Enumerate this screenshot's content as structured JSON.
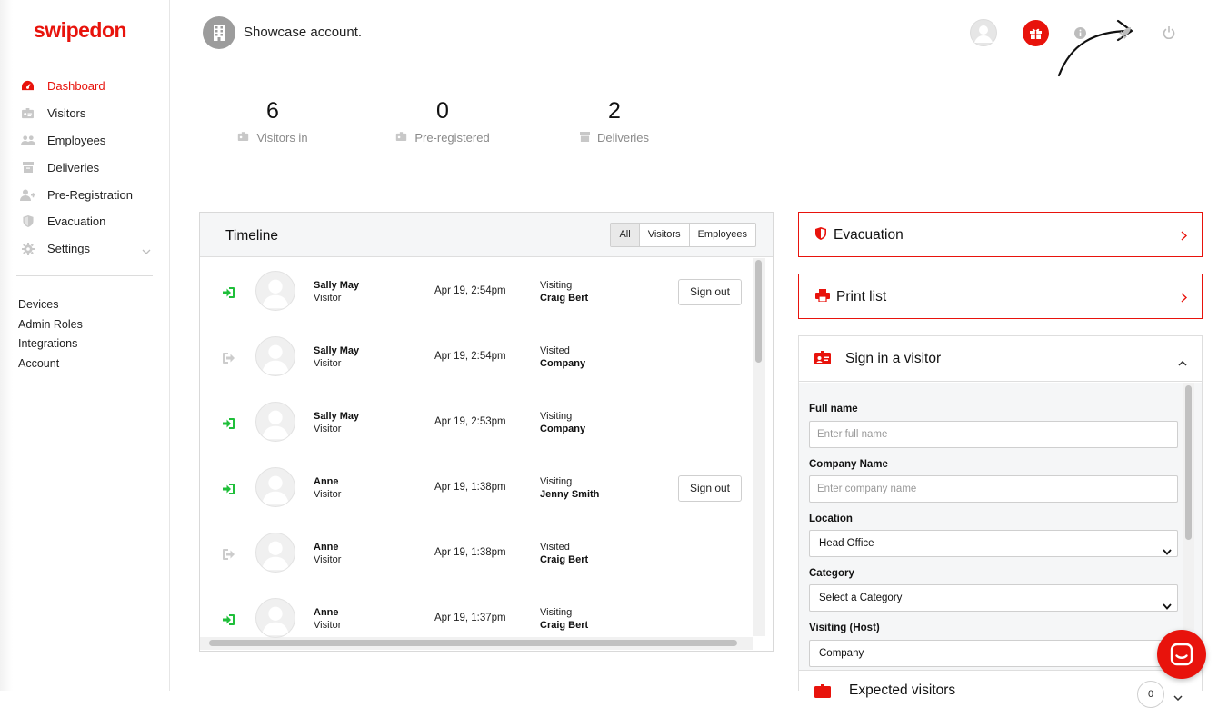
{
  "app": {
    "logo": "swipedon",
    "account_name": "Showcase account."
  },
  "colors": {
    "brand": "#e8130c",
    "sign_in_green": "#1fbf3a",
    "muted_icon": "#bdbdbd"
  },
  "sidebar": {
    "items": [
      {
        "label": "Dashboard",
        "icon": "gauge-icon",
        "active": true
      },
      {
        "label": "Visitors",
        "icon": "id-card-icon"
      },
      {
        "label": "Employees",
        "icon": "users-icon"
      },
      {
        "label": "Deliveries",
        "icon": "box-icon"
      },
      {
        "label": "Pre-Registration",
        "icon": "user-plus-icon"
      },
      {
        "label": "Evacuation",
        "icon": "shield-icon"
      },
      {
        "label": "Settings",
        "icon": "gear-icon",
        "expandable": true
      }
    ],
    "secondary": [
      "Devices",
      "Admin Roles",
      "Integrations",
      "Account"
    ]
  },
  "stats": [
    {
      "value": "6",
      "label": "Visitors in",
      "icon": "id-card-icon"
    },
    {
      "value": "0",
      "label": "Pre-registered",
      "icon": "id-card-icon"
    },
    {
      "value": "2",
      "label": "Deliveries",
      "icon": "box-icon"
    }
  ],
  "timeline": {
    "title": "Timeline",
    "filters": [
      "All",
      "Visitors",
      "Employees"
    ],
    "active_filter": "All",
    "sign_out_label": "Sign out",
    "rows": [
      {
        "name": "Sally May",
        "type": "Visitor",
        "time": "Apr 19, 2:54pm",
        "status": "Visiting",
        "host": "Craig Bert",
        "signed_in": true
      },
      {
        "name": "Sally May",
        "type": "Visitor",
        "time": "Apr 19, 2:54pm",
        "status": "Visited",
        "host": "Company",
        "signed_in": false
      },
      {
        "name": "Sally May",
        "type": "Visitor",
        "time": "Apr 19, 2:53pm",
        "status": "Visiting",
        "host": "Company",
        "signed_in": true
      },
      {
        "name": "Anne",
        "type": "Visitor",
        "time": "Apr 19, 1:38pm",
        "status": "Visiting",
        "host": "Jenny Smith",
        "signed_in": true
      },
      {
        "name": "Anne",
        "type": "Visitor",
        "time": "Apr 19, 1:38pm",
        "status": "Visited",
        "host": "Craig Bert",
        "signed_in": false
      },
      {
        "name": "Anne",
        "type": "Visitor",
        "time": "Apr 19, 1:37pm",
        "status": "Visiting",
        "host": "Craig Bert",
        "signed_in": true
      }
    ]
  },
  "evacuation": {
    "label": "Evacuation"
  },
  "print_list": {
    "label": "Print list"
  },
  "sign_in_visitor": {
    "title": "Sign in a visitor",
    "full_name_label": "Full name",
    "full_name_placeholder": "Enter full name",
    "company_label": "Company Name",
    "company_placeholder": "Enter company name",
    "location_label": "Location",
    "location_value": "Head Office",
    "category_label": "Category",
    "category_value": "Select a Category",
    "host_label": "Visiting (Host)",
    "host_value": "Company"
  },
  "expected_visitors": {
    "title": "Expected visitors",
    "count": "0"
  }
}
